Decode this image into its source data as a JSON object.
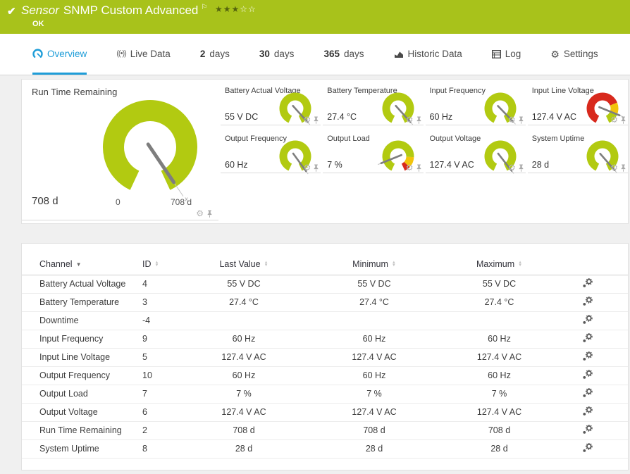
{
  "colors": {
    "header_bg": "#a8c21b",
    "accent": "#1e9dd8",
    "gauge_green": "#b2ca11",
    "gauge_yellow": "#f2c40c",
    "gauge_red": "#d8291d"
  },
  "header": {
    "check": "✔",
    "kind": "Sensor",
    "title": "SNMP Custom Advanced",
    "flag": "⚐",
    "stars_filled": "★★★",
    "stars_empty": "☆☆",
    "status": "OK"
  },
  "tabs": [
    {
      "label": "Overview",
      "icon": "gauge",
      "active": true
    },
    {
      "label": "Live Data",
      "icon": "live"
    },
    {
      "num": "2",
      "label": "days"
    },
    {
      "num": "30",
      "label": "days"
    },
    {
      "num": "365",
      "label": "days"
    },
    {
      "label": "Historic Data",
      "icon": "chart"
    },
    {
      "label": "Log",
      "icon": "log"
    },
    {
      "label": "Settings",
      "icon": "gear"
    }
  ],
  "main_gauge": {
    "title": "Run Time Remaining",
    "value": "708 d",
    "scale_min": "0",
    "scale_max": "708 d",
    "needle_deg": 146,
    "segments": [
      {
        "color": "#b2ca11",
        "from": 0,
        "to": 1
      }
    ]
  },
  "small_gauges": [
    {
      "title": "Battery Actual Voltage",
      "value": "55 V DC",
      "needle_deg": 138,
      "segments": [
        {
          "color": "#b2ca11",
          "from": 0,
          "to": 1
        }
      ]
    },
    {
      "title": "Battery Temperature",
      "value": "27.4 °C",
      "needle_deg": 138,
      "segments": [
        {
          "color": "#b2ca11",
          "from": 0,
          "to": 1
        }
      ]
    },
    {
      "title": "Input Frequency",
      "value": "60 Hz",
      "needle_deg": 136,
      "segments": [
        {
          "color": "#b2ca11",
          "from": 0,
          "to": 1
        }
      ]
    },
    {
      "title": "Input Line Voltage",
      "value": "127.4 V AC",
      "needle_deg": 112,
      "segments": [
        {
          "color": "#d8291d",
          "from": 0,
          "to": 0.72
        },
        {
          "color": "#f2c40c",
          "from": 0.72,
          "to": 0.87
        },
        {
          "color": "#b2ca11",
          "from": 0.87,
          "to": 1
        }
      ]
    },
    {
      "title": "Output Frequency",
      "value": "60 Hz",
      "needle_deg": 144,
      "segments": [
        {
          "color": "#b2ca11",
          "from": 0,
          "to": 1
        }
      ]
    },
    {
      "title": "Output Load",
      "value": "7 %",
      "needle_deg": 248,
      "segments": [
        {
          "color": "#b2ca11",
          "from": 0,
          "to": 0.8
        },
        {
          "color": "#f2c40c",
          "from": 0.8,
          "to": 0.93
        },
        {
          "color": "#d8291d",
          "from": 0.93,
          "to": 1
        }
      ]
    },
    {
      "title": "Output Voltage",
      "value": "127.4 V AC",
      "needle_deg": 142,
      "segments": [
        {
          "color": "#b2ca11",
          "from": 0,
          "to": 1
        }
      ]
    },
    {
      "title": "System Uptime",
      "value": "28 d",
      "needle_deg": 139,
      "segments": [
        {
          "color": "#b2ca11",
          "from": 0,
          "to": 1
        }
      ]
    }
  ],
  "table": {
    "columns": [
      {
        "label": "Channel",
        "sort": "desc"
      },
      {
        "label": "ID",
        "sort": "both"
      },
      {
        "label": "Last Value",
        "sort": "both"
      },
      {
        "label": "Minimum",
        "sort": "both"
      },
      {
        "label": "Maximum",
        "sort": "both"
      }
    ],
    "rows": [
      [
        "Battery Actual Voltage",
        "4",
        "55 V DC",
        "55 V DC",
        "55 V DC"
      ],
      [
        "Battery Temperature",
        "3",
        "27.4 °C",
        "27.4 °C",
        "27.4 °C"
      ],
      [
        "Downtime",
        "-4",
        "",
        "",
        ""
      ],
      [
        "Input Frequency",
        "9",
        "60 Hz",
        "60 Hz",
        "60 Hz"
      ],
      [
        "Input Line Voltage",
        "5",
        "127.4 V AC",
        "127.4 V AC",
        "127.4 V AC"
      ],
      [
        "Output Frequency",
        "10",
        "60 Hz",
        "60 Hz",
        "60 Hz"
      ],
      [
        "Output Load",
        "7",
        "7 %",
        "7 %",
        "7 %"
      ],
      [
        "Output Voltage",
        "6",
        "127.4 V AC",
        "127.4 V AC",
        "127.4 V AC"
      ],
      [
        "Run Time Remaining",
        "2",
        "708 d",
        "708 d",
        "708 d"
      ],
      [
        "System Uptime",
        "8",
        "28 d",
        "28 d",
        "28 d"
      ]
    ]
  }
}
